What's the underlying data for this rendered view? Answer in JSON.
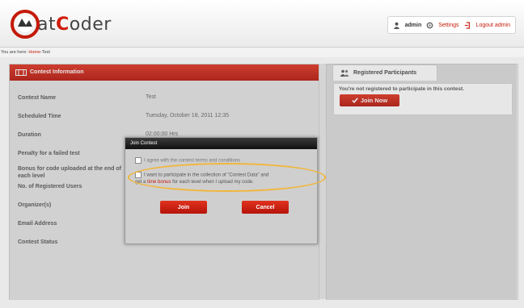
{
  "header": {
    "logo_prefix": "at",
    "logo_suffix": "oder",
    "logo_c": "C",
    "username": "admin",
    "settings_label": "Settings",
    "logout_prefix": "Logout",
    "logout_user": "admin"
  },
  "breadcrumb": {
    "prefix": "You are here:",
    "home": "Home",
    "separator": "-",
    "current": "Test"
  },
  "contest_info": {
    "title": "Contest Information",
    "rows": [
      {
        "label": "Contest Name",
        "value": "Test"
      },
      {
        "label": "Scheduled Time",
        "value": "Tuesday, October 18, 2011 12:35"
      },
      {
        "label": "Duration",
        "value": "02:00:00 Hrs"
      },
      {
        "label": "Penalty for a failed test",
        "value": ""
      },
      {
        "label": "Bonus for code uploaded at the end of each level",
        "value": ""
      },
      {
        "label": "No. of Registered Users",
        "value": ""
      },
      {
        "label": "Organizer(s)",
        "value": ""
      },
      {
        "label": "Email Address",
        "value": ""
      },
      {
        "label": "Contest Status",
        "value": ""
      }
    ]
  },
  "participants": {
    "tab_label": "Registered Participants",
    "message": "You're not registered to participate in this contest.",
    "join_now_label": "Join Now"
  },
  "modal": {
    "title": "Join Contest",
    "agree_text": "I agree with the contest terms and conditions",
    "data_text_1": "I want to participate in the collection of \"Contest Data\" and",
    "data_text_2_prefix": "get a",
    "data_text_2_link": "time bonus",
    "data_text_2_suffix": "for each level when I upload my code.",
    "join_label": "Join",
    "cancel_label": "Cancel"
  },
  "colors": {
    "accent": "#c41a0a",
    "highlight_ring": "#f1b63c"
  }
}
